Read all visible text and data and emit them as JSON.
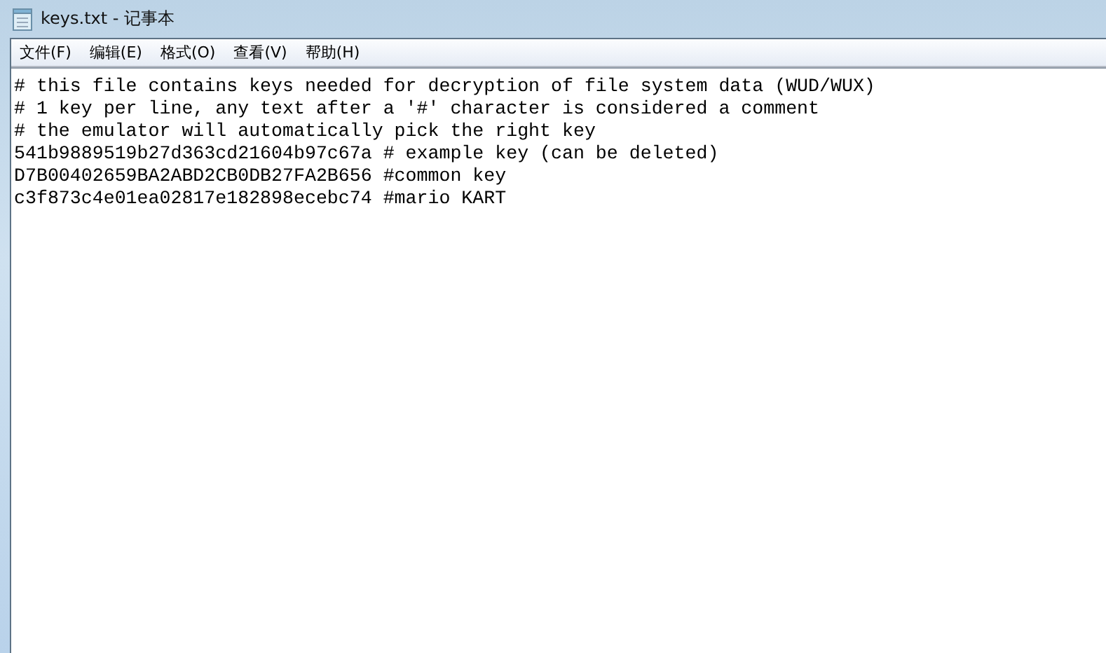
{
  "window": {
    "title": "keys.txt - 记事本"
  },
  "menu": [
    {
      "label": "文件(F)"
    },
    {
      "label": "编辑(E)"
    },
    {
      "label": "格式(O)"
    },
    {
      "label": "查看(V)"
    },
    {
      "label": "帮助(H)"
    }
  ],
  "editor": {
    "lines": [
      "# this file contains keys needed for decryption of file system data (WUD/WUX)",
      "# 1 key per line, any text after a '#' character is considered a comment",
      "# the emulator will automatically pick the right key",
      "541b9889519b27d363cd21604b97c67a # example key (can be deleted)",
      "D7B00402659BA2ABD2CB0DB27FA2B656 #common key",
      "c3f873c4e01ea02817e182898ecebc74 #mario KART"
    ]
  }
}
